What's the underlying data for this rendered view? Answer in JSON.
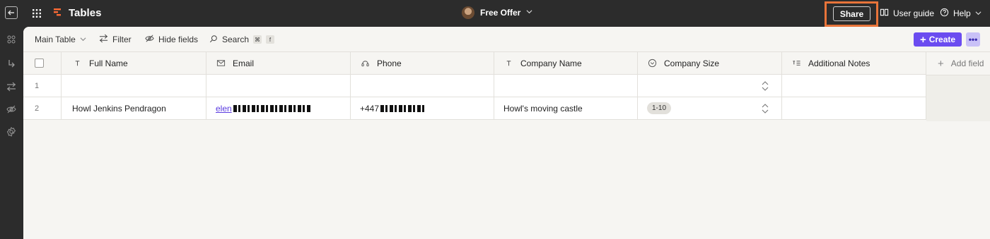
{
  "app": {
    "brand": "Tables",
    "title": "Free Offer",
    "share_label": "Share",
    "user_guide_label": "User guide",
    "help_label": "Help"
  },
  "toolbar": {
    "view_label": "Main Table",
    "filter_label": "Filter",
    "hide_fields_label": "Hide fields",
    "search_label": "Search",
    "search_key1": "⌘",
    "search_key2": "f",
    "create_label": "Create",
    "more_label": "•••"
  },
  "table": {
    "columns": [
      {
        "label": "Full Name",
        "icon": "text-type-icon"
      },
      {
        "label": "Email",
        "icon": "email-icon"
      },
      {
        "label": "Phone",
        "icon": "phone-icon"
      },
      {
        "label": "Company Name",
        "icon": "text-type-icon"
      },
      {
        "label": "Company Size",
        "icon": "dropdown-type-icon"
      },
      {
        "label": "Additional Notes",
        "icon": "long-text-icon"
      }
    ],
    "add_field_label": "Add field",
    "rows": [
      {
        "num": "1",
        "full_name": "",
        "email": "",
        "phone": "",
        "company_name": "",
        "company_size": "",
        "notes": ""
      },
      {
        "num": "2",
        "full_name": "Howl Jenkins Pendragon",
        "email": "elen",
        "phone": "+447",
        "company_name": "Howl's moving castle",
        "company_size": "1-10",
        "notes": ""
      }
    ]
  },
  "colors": {
    "accent": "#6b4cf0",
    "highlight": "#e8743a",
    "topbar": "#2c2c2c"
  }
}
